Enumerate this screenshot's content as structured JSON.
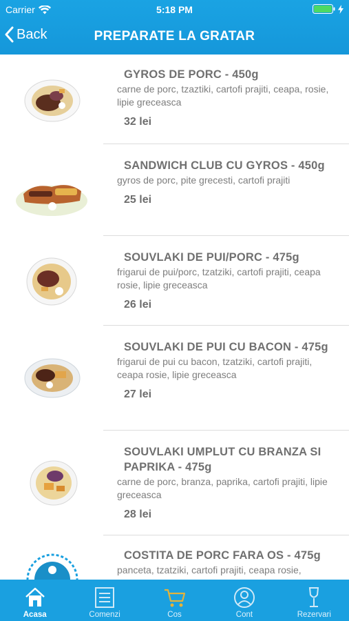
{
  "status_bar": {
    "carrier": "Carrier",
    "time": "5:18 PM"
  },
  "nav": {
    "back_label": "Back",
    "title": "PREPARATE LA GRATAR"
  },
  "items": [
    {
      "name": "GYROS DE PORC - 450g",
      "description": "carne de porc, tzaztiki, cartofi prajiti, ceapa, rosie, lipie greceasca",
      "price": "32 lei"
    },
    {
      "name": "SANDWICH CLUB CU GYROS - 450g",
      "description": "gyros de porc, pite grecesti, cartofi prajiti",
      "price": "25 lei"
    },
    {
      "name": "SOUVLAKI DE PUI/PORC - 475g",
      "description": "frigarui de pui/porc, tzatziki, cartofi prajiti, ceapa rosie, lipie greceasca",
      "price": "26 lei"
    },
    {
      "name": "SOUVLAKI DE PUI CU BACON - 475g",
      "description": "frigarui de pui cu bacon, tzatziki, cartofi prajiti, ceapa rosie, lipie greceasca",
      "price": "27 lei"
    },
    {
      "name": "SOUVLAKI UMPLUT CU BRANZA SI PAPRIKA - 475g",
      "description": "carne de porc, branza, paprika, cartofi prajiti, lipie greceasca",
      "price": "28 lei"
    },
    {
      "name": "COSTITA DE PORC FARA OS - 475g",
      "description": "panceta, tzatziki, cartofi prajiti, ceapa rosie,",
      "price": ""
    }
  ],
  "tabs": [
    {
      "label": "Acasa",
      "icon": "home-icon",
      "active": true
    },
    {
      "label": "Comenzi",
      "icon": "list-icon",
      "active": false
    },
    {
      "label": "Cos",
      "icon": "cart-icon",
      "active": false
    },
    {
      "label": "Cont",
      "icon": "user-icon",
      "active": false
    },
    {
      "label": "Rezervari",
      "icon": "wine-glass-icon",
      "active": false
    }
  ],
  "colors": {
    "accent": "#1aa0e0",
    "cart_icon": "#e3b33b"
  }
}
